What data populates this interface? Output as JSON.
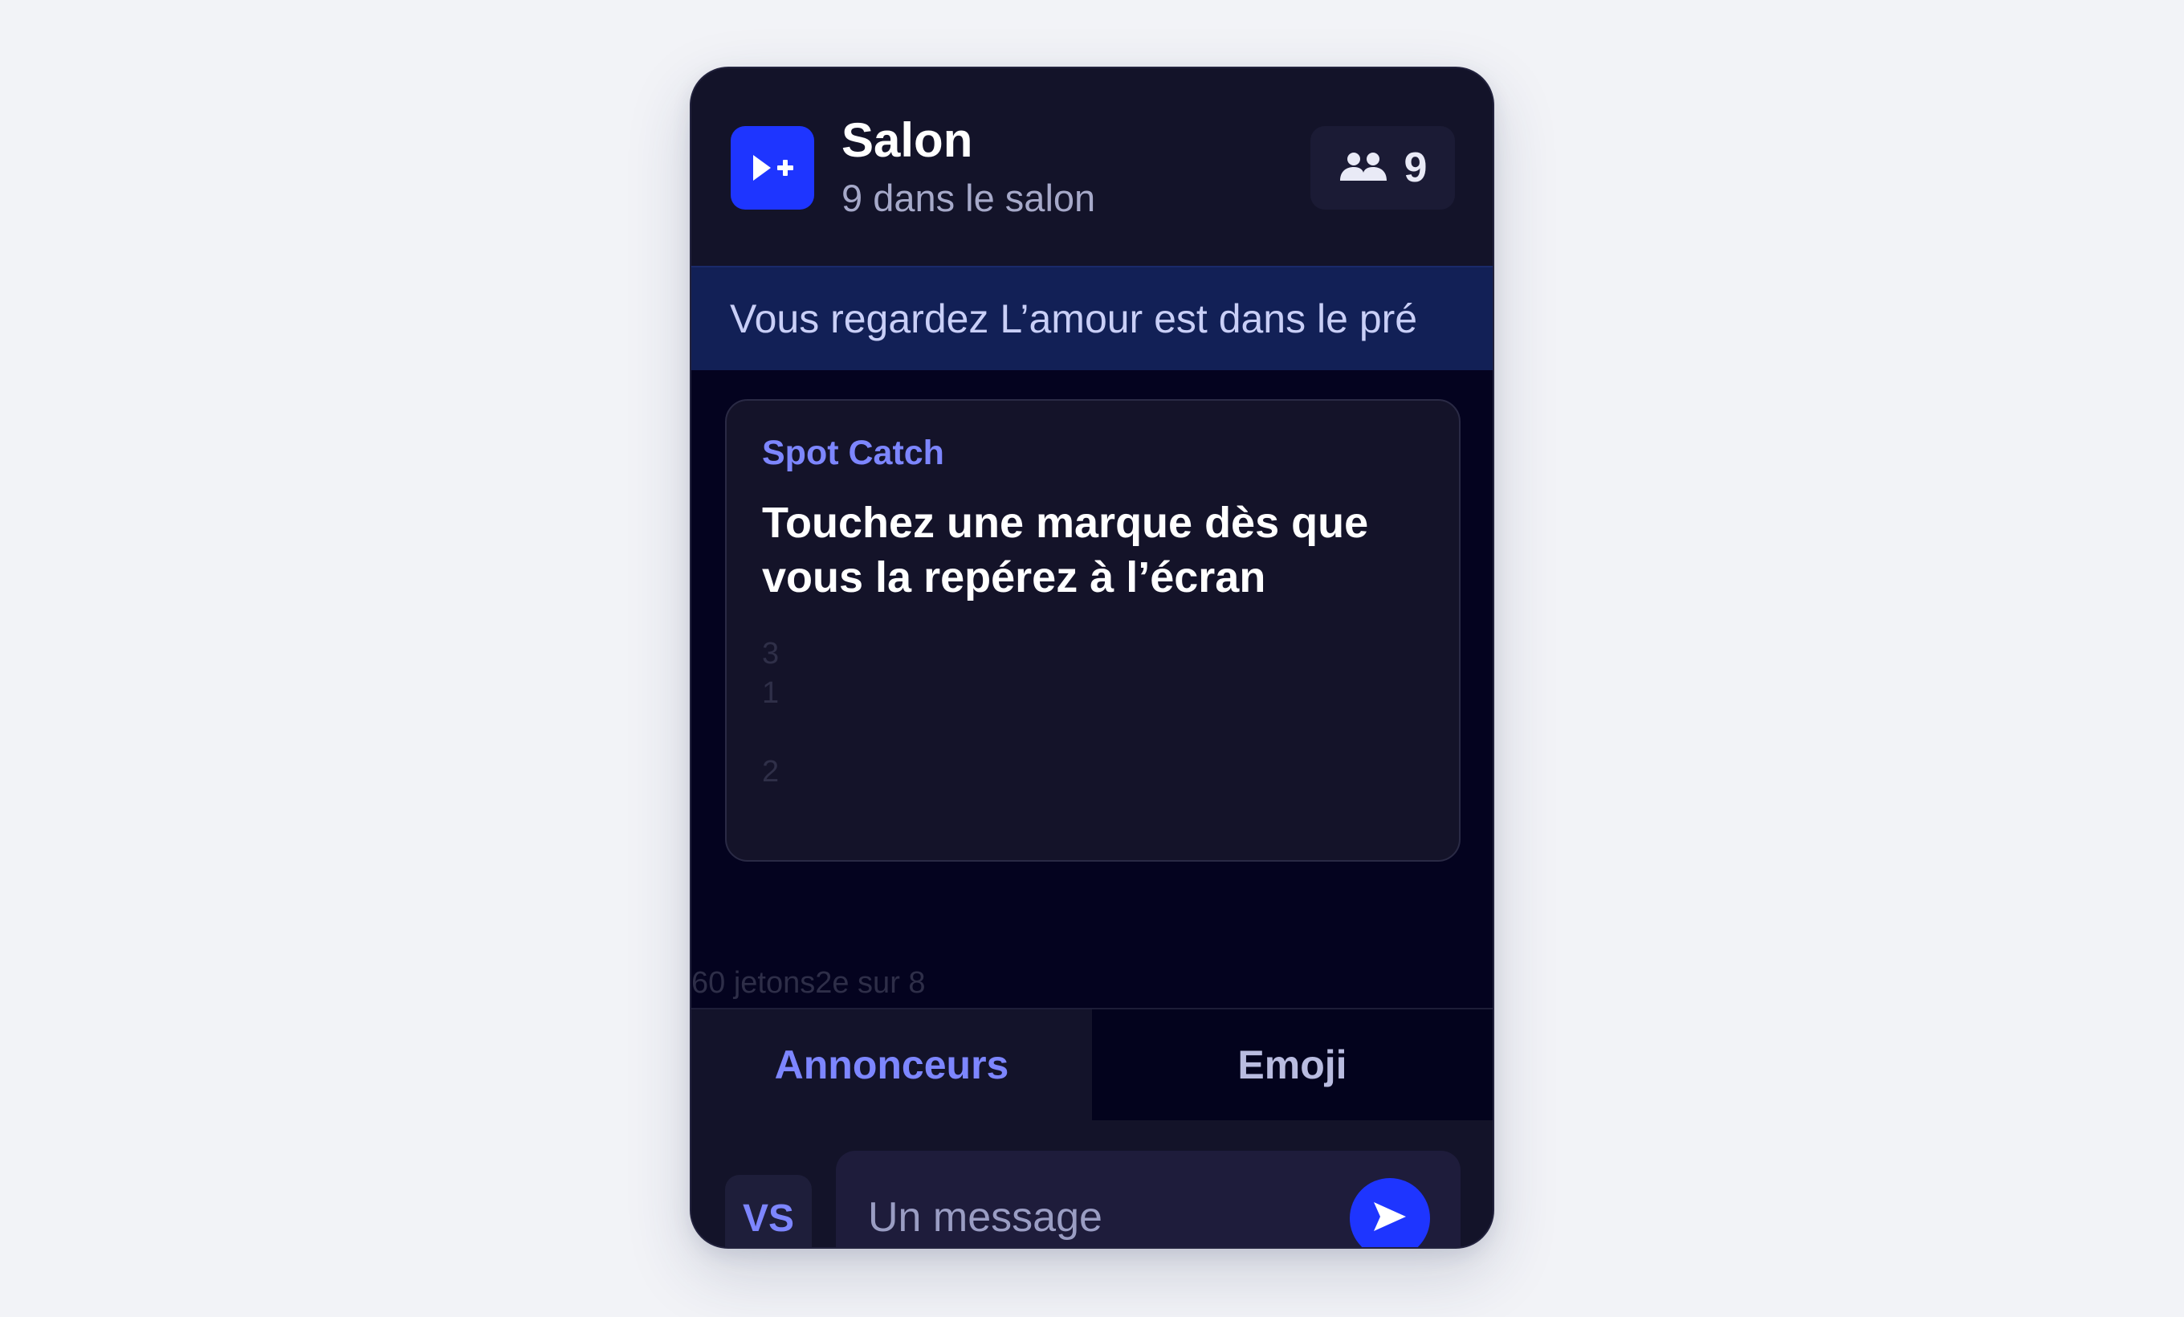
{
  "header": {
    "title": "Salon",
    "subtitle": "9 dans le salon",
    "viewer_count": "9",
    "logo_icon": "play-plus-icon",
    "viewers_icon": "users-icon"
  },
  "now_watching": {
    "text": "Vous regardez L’amour est dans le pré"
  },
  "game": {
    "name": "Spot Catch",
    "instruction": "Touchez une marque dès que vous la repérez à l’écran",
    "spots": [
      "3",
      "1",
      "2"
    ]
  },
  "footer": {
    "tokens": "60 jetons",
    "rank": "2e sur 8"
  },
  "tabs": [
    {
      "label": "Annonceurs",
      "active": true
    },
    {
      "label": "Emoji",
      "active": false
    }
  ],
  "composer": {
    "avatar_initials": "VS",
    "placeholder": "Un message",
    "send_icon": "send-icon"
  },
  "colors": {
    "accent": "#1e35ff",
    "accent_text": "#7d86ff",
    "panel": "#131329",
    "banner": "#122056"
  }
}
